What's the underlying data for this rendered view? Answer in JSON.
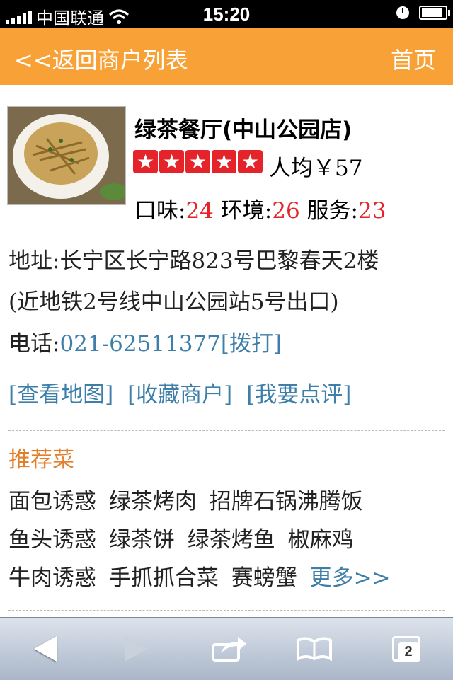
{
  "statusbar": {
    "carrier": "中国联通",
    "time": "15:20"
  },
  "nav": {
    "back_label": "<<返回商户列表",
    "home_label": "首页"
  },
  "shop": {
    "name": "绿茶餐厅(中山公园店)",
    "stars_rating": 5,
    "avg_price": "人均￥57",
    "taste_label": "口味:",
    "taste": "24",
    "env_label": "环境:",
    "env": "26",
    "service_label": "服务:",
    "service": "23"
  },
  "address": {
    "label": "地址:",
    "line1": "长宁区长宁路823号巴黎春天2楼",
    "line2": "(近地铁2号线中山公园站5号出口)"
  },
  "phone": {
    "label": "电话:",
    "number": "021-62511377",
    "call": "[拨打]"
  },
  "actions": {
    "map": "[查看地图]",
    "fav": "[收藏商户]",
    "review": "[我要点评]"
  },
  "recommend": {
    "title": "推荐菜",
    "dishes": [
      "面包诱惑",
      "绿茶烤肉",
      "招牌石锅沸腾饭",
      "鱼头诱惑",
      "绿茶饼",
      "绿茶烤鱼",
      "椒麻鸡",
      "牛肉诱惑",
      "手抓抓合菜",
      "赛螃蟹"
    ],
    "more": "更多>>"
  },
  "toolbar": {
    "tabs_count": "2"
  }
}
